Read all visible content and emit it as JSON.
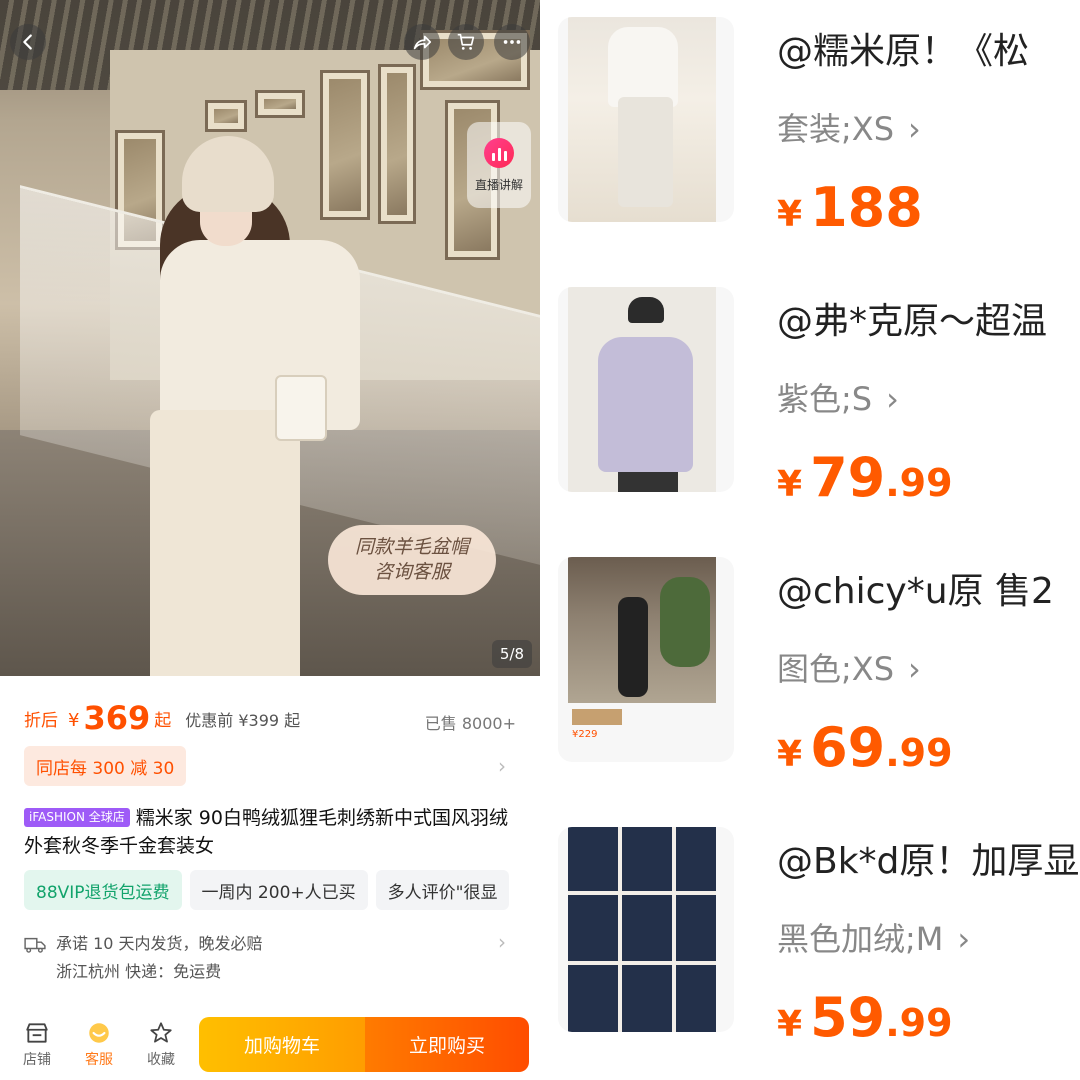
{
  "hero": {
    "live_label": "直播讲解",
    "bubble_line1": "同款羊毛盆帽",
    "bubble_line2": "咨询客服",
    "image_counter": "5/8"
  },
  "price": {
    "prefix": "折后",
    "currency": "¥",
    "amount": "369",
    "suffix": "起",
    "original": "优惠前 ¥399 起",
    "sold": "已售 8000+"
  },
  "coupon": {
    "label": "同店每 300 减 30"
  },
  "product": {
    "badge": "iFASHION 全球店",
    "title": "糯米家 90白鸭绒狐狸毛刺绣新中式国风羽绒外套秋冬季千金套装女"
  },
  "tags": [
    "88VIP退货包运费",
    "一周内 200+人已买",
    "多人评价\"很显"
  ],
  "shipping": {
    "line1": "承诺 10 天内发货，晚发必赔",
    "line2": "浙江杭州  快递：免运费"
  },
  "bottom_bar": {
    "shop": "店铺",
    "service": "客服",
    "favorite": "收藏",
    "add_to_cart": "加购物车",
    "buy_now": "立即购买"
  },
  "listings": [
    {
      "title": "@糯米原！《松",
      "variant": "套装;XS",
      "currency": "¥",
      "int": "188",
      "dec": ""
    },
    {
      "title": "@弗*克原～超温",
      "variant": "紫色;S",
      "currency": "¥",
      "int": "79",
      "dec": ".99"
    },
    {
      "title": "@chicy*u原 售2",
      "variant": "图色;XS",
      "currency": "¥",
      "int": "69",
      "dec": ".99"
    },
    {
      "title": "@Bk*d原！加厚显",
      "variant": "黑色加绒;M",
      "currency": "¥",
      "int": "59",
      "dec": ".99"
    }
  ],
  "listing_thumb3_price": "¥229",
  "colors": {
    "accent": "#ff5000",
    "vip_green": "#12a36b",
    "ifashion_purple": "#9e5bf7"
  }
}
